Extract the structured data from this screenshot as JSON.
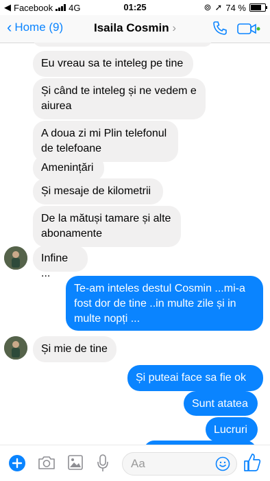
{
  "status_bar": {
    "carrier": "Facebook",
    "network": "4G",
    "time": "01:25",
    "battery": "74 %",
    "battery_level": 0.74
  },
  "header": {
    "back_label": "Home (9)",
    "contact_name": "Isaila Cosmin"
  },
  "messages": [
    {
      "dir": "in",
      "text": "Eu vreau sa te inteleg pe tine"
    },
    {
      "dir": "in",
      "text": "Și când te inteleg și ne vedem e aiurea"
    },
    {
      "dir": "in",
      "text": "A doua zi mi Plin telefonul de telefoane"
    },
    {
      "dir": "in",
      "text": "Amenințări"
    },
    {
      "dir": "in",
      "text": "Și mesaje de kilometrii"
    },
    {
      "dir": "in",
      "text": "De la mătuși tamare și alte abonamente"
    },
    {
      "dir": "in",
      "text": "Infine ..."
    },
    {
      "dir": "out",
      "text": "Te-am inteles destul Cosmin ...mi-a fost dor de tine ..in multe zile și in multe nopți ..."
    },
    {
      "dir": "in",
      "text": "Și mie de tine"
    },
    {
      "dir": "out",
      "text": "Și puteai face sa fie ok"
    },
    {
      "dir": "out",
      "text": "Sunt atatea"
    },
    {
      "dir": "out",
      "text": "Lucruri"
    }
  ],
  "composer": {
    "placeholder": "Aa"
  },
  "colors": {
    "accent": "#0a84ff",
    "incoming_bubble": "#f1f0f0",
    "online_dot": "#44bd32"
  },
  "icons": [
    "signal-icon",
    "location-icon",
    "back-chevron-icon",
    "phone-icon",
    "video-icon",
    "plus-icon",
    "camera-icon",
    "image-icon",
    "microphone-icon",
    "emoji-icon",
    "like-icon"
  ]
}
